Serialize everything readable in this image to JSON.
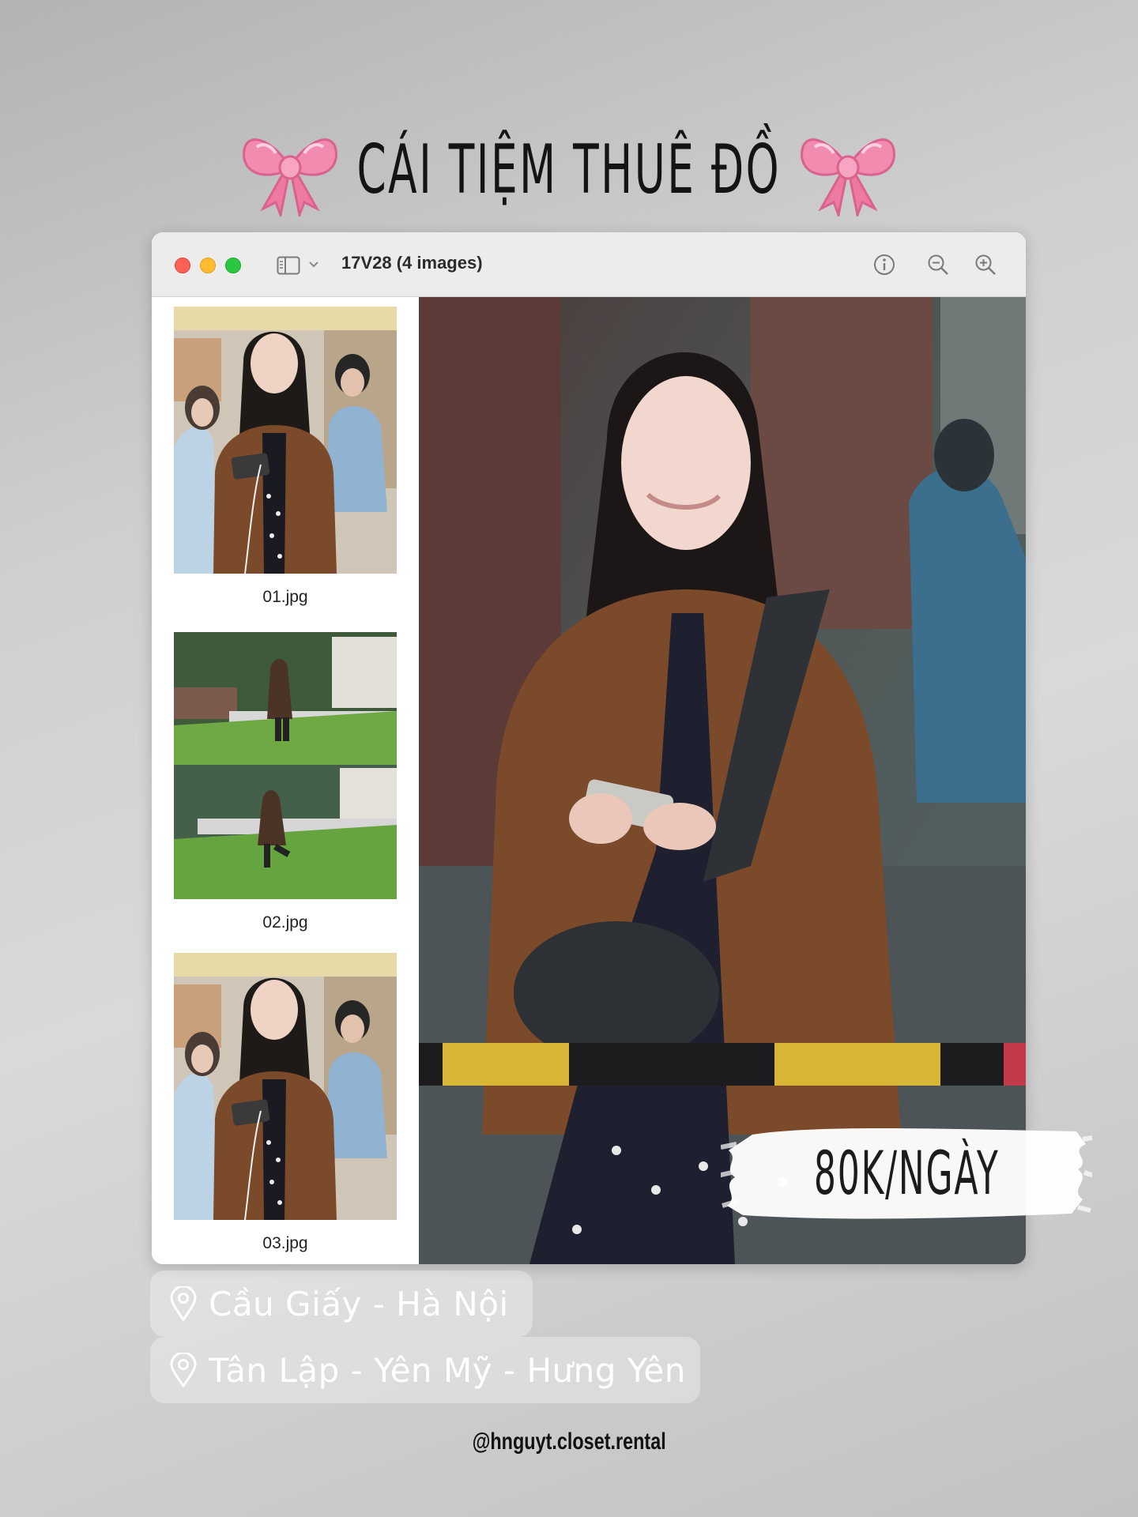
{
  "headline": {
    "text": "CÁI TIỆM THUÊ ĐỒ",
    "decoration": "pink-ribbon-bow"
  },
  "window": {
    "title": "17V28 (4 images)",
    "toolbar": {
      "sidebar_toggle_icon": "sidebar-icon",
      "info_icon": "info-icon",
      "zoom_out_icon": "zoom-out-icon",
      "zoom_in_icon": "zoom-in-icon"
    },
    "thumbnails": [
      {
        "label": "01.jpg"
      },
      {
        "label": "02.jpg"
      },
      {
        "label": "03.jpg"
      }
    ]
  },
  "price": "80K/NGÀY",
  "locations": [
    {
      "text": "Cầu Giấy - Hà Nội",
      "icon": "location-pin-icon"
    },
    {
      "text": "Tân Lập - Yên Mỹ - Hưng Yên",
      "icon": "location-pin-icon"
    }
  ],
  "handle": "@hnguyt.closet.rental",
  "colors": {
    "traffic_close": "#fe5f57",
    "traffic_minimize": "#febc2e",
    "traffic_maximize": "#28c840",
    "bow_pink": "#f28bb0",
    "jacket_brown": "#7a4a2a"
  }
}
